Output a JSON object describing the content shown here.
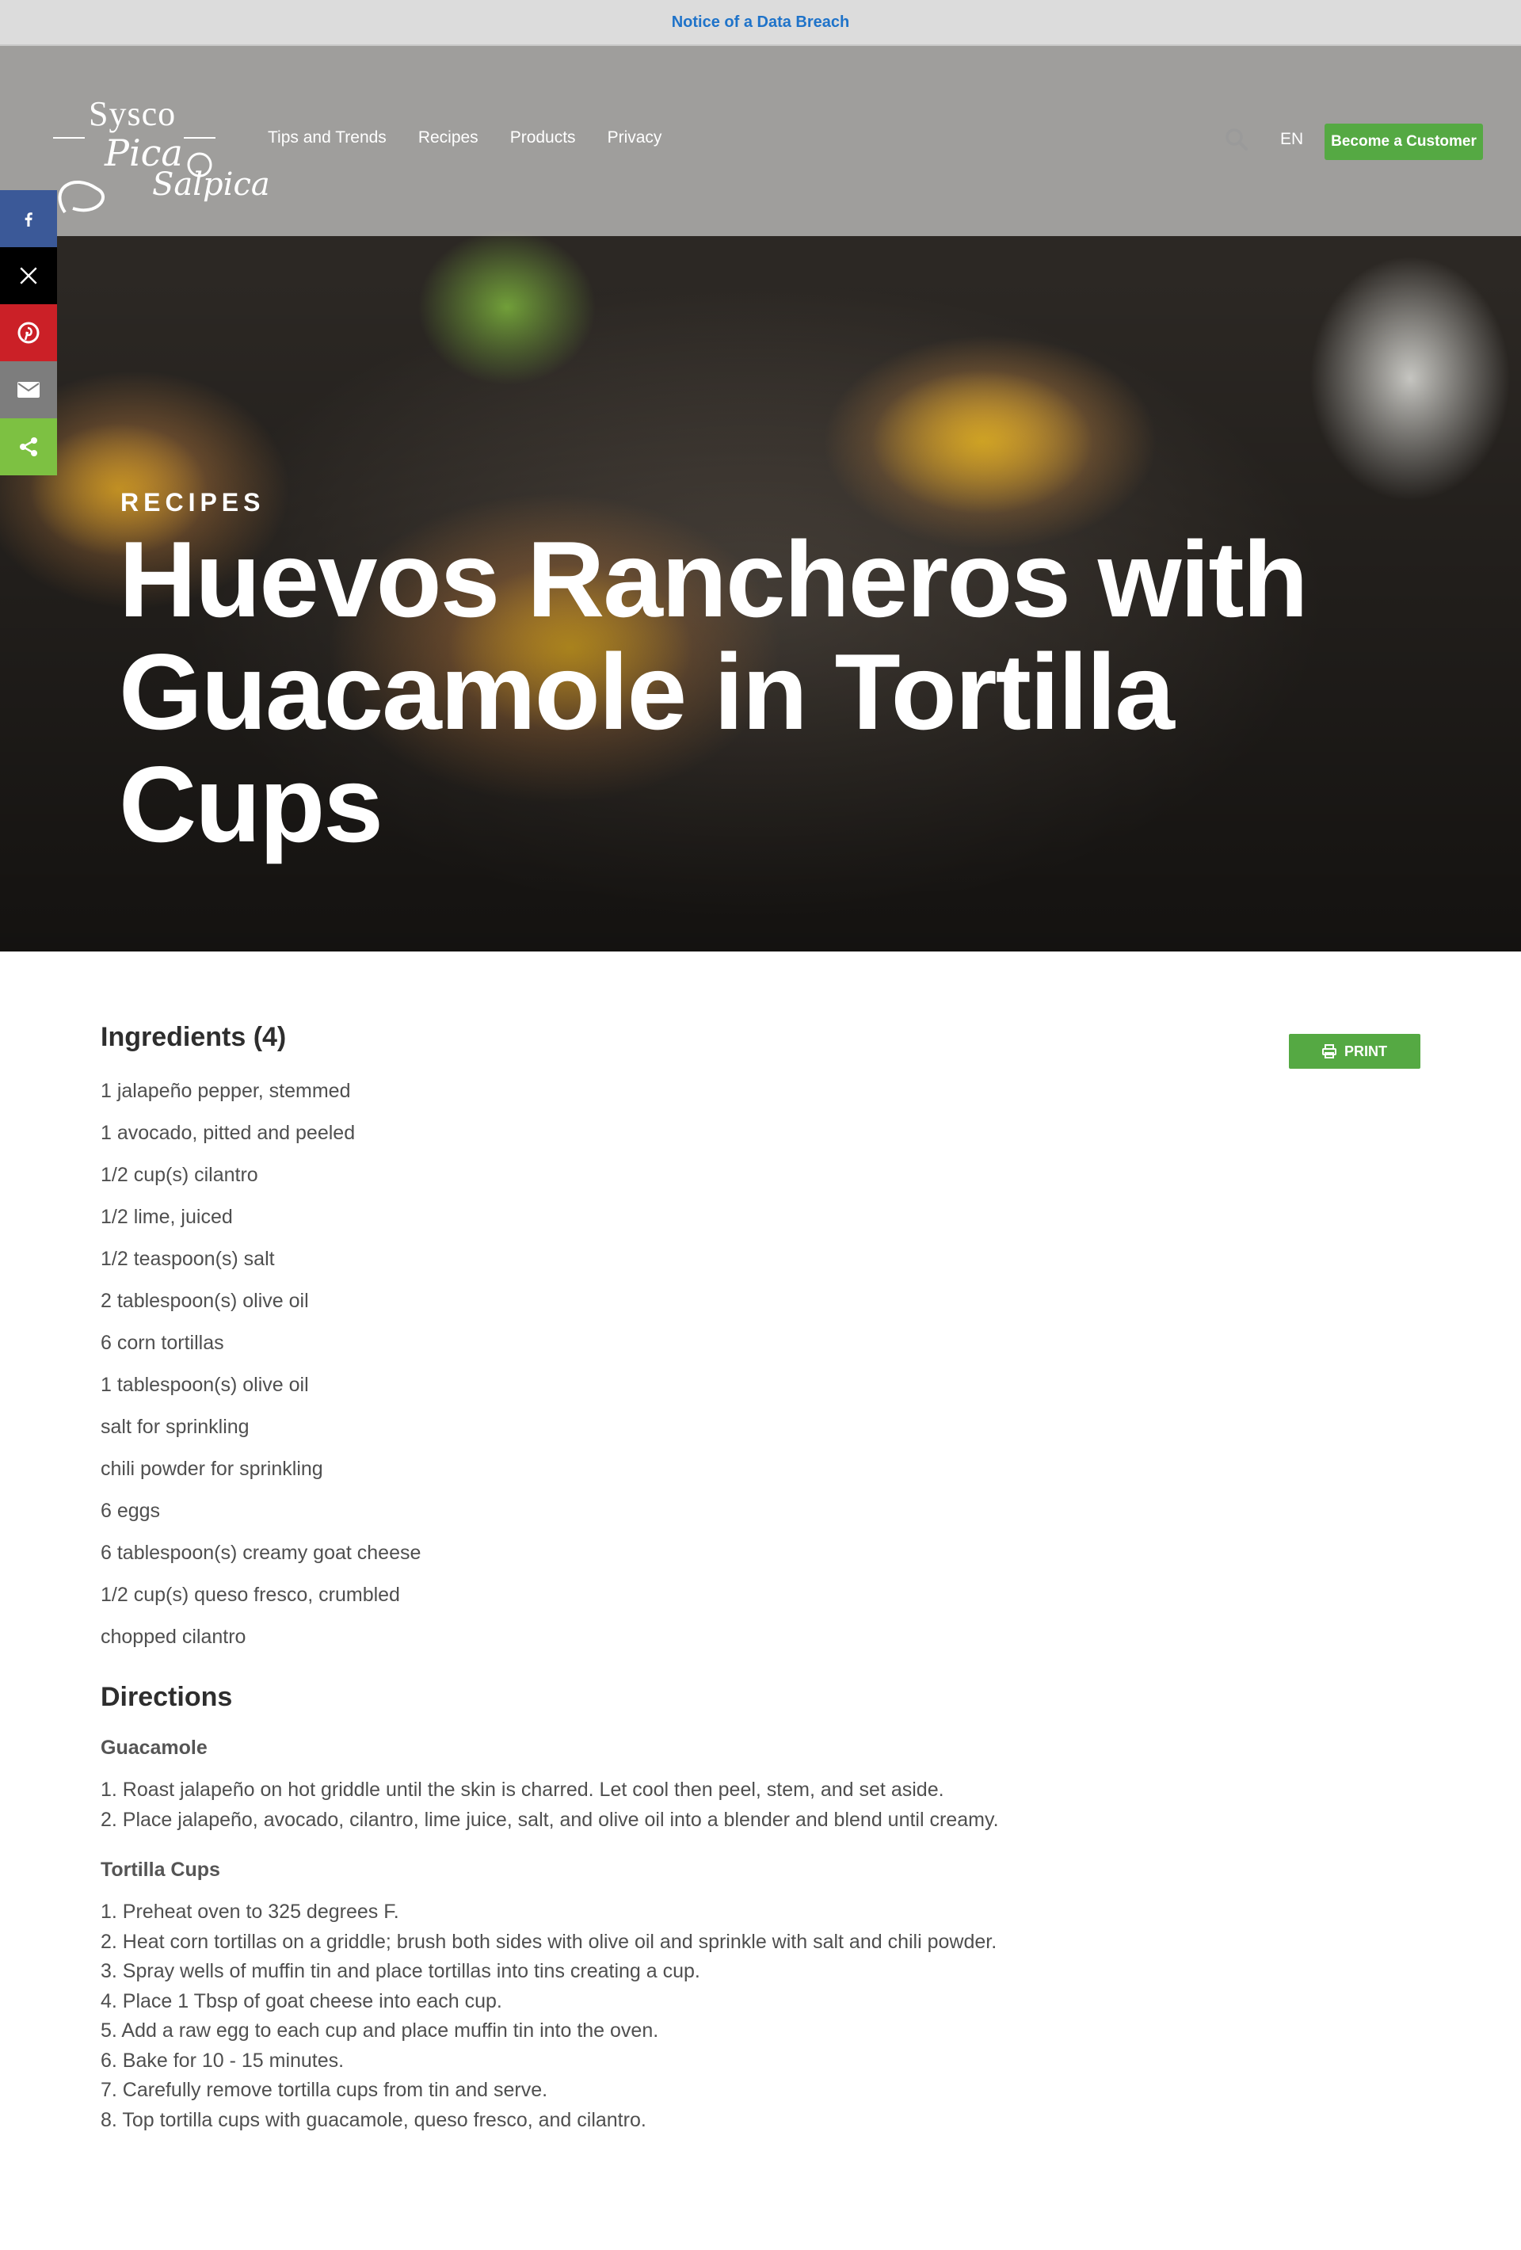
{
  "notice": {
    "text": "Notice of a Data Breach"
  },
  "logo": {
    "brand": "Sysco",
    "script_line1": "Pica",
    "script_line2": "Salpica"
  },
  "nav": {
    "items": [
      "Tips and Trends",
      "Recipes",
      "Products",
      "Privacy"
    ]
  },
  "header": {
    "lang": "EN",
    "cta": "Become a Customer"
  },
  "hero": {
    "kicker": "RECIPES",
    "title": "Huevos Rancheros with Guacamole in Tortilla Cups"
  },
  "share": {
    "items": [
      "facebook-icon",
      "x-icon",
      "pinterest-icon",
      "email-icon",
      "share-icon"
    ]
  },
  "ingredients": {
    "title": "Ingredients (4)",
    "print_label": "PRINT",
    "items": [
      "1 jalapeño pepper, stemmed",
      "1 avocado, pitted and peeled",
      "1/2 cup(s) cilantro",
      "1/2 lime, juiced",
      "1/2 teaspoon(s) salt",
      "2 tablespoon(s) olive oil",
      "6 corn tortillas",
      "1 tablespoon(s) olive oil",
      "salt for sprinkling",
      "chili powder for sprinkling",
      "6 eggs",
      "6 tablespoon(s) creamy goat cheese",
      "1/2 cup(s) queso fresco, crumbled",
      "chopped cilantro"
    ]
  },
  "directions": {
    "title": "Directions",
    "sections": [
      {
        "name": "Guacamole",
        "steps": [
          "1. Roast jalapeño on hot griddle until the skin is charred. Let cool then peel, stem, and set aside.",
          "2. Place jalapeño, avocado, cilantro, lime juice, salt, and olive oil into a blender and blend until creamy."
        ]
      },
      {
        "name": "Tortilla Cups",
        "steps": [
          "1. Preheat oven to 325 degrees F.",
          "2. Heat corn tortillas on a griddle; brush both sides with olive oil and sprinkle with salt and chili powder.",
          "3. Spray wells of muffin tin and place tortillas into tins creating a cup.",
          "4. Place 1 Tbsp of goat cheese into each cup.",
          "5. Add a raw egg to each cup and place muffin tin into the oven.",
          "6. Bake for 10 - 15 minutes.",
          "7. Carefully remove tortilla cups from tin and serve.",
          "8. Top tortilla cups with guacamole, queso fresco, and cilantro."
        ]
      }
    ]
  },
  "colors": {
    "accent_green": "#55a943",
    "notice_link": "#1f73c9",
    "facebook": "#3b5998",
    "pinterest": "#cb2027",
    "share_green": "#7dc142"
  }
}
